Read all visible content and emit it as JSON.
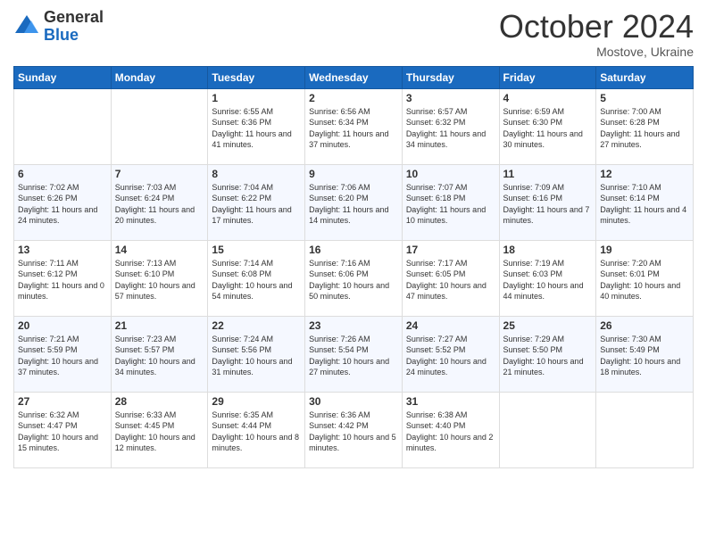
{
  "logo": {
    "general": "General",
    "blue": "Blue"
  },
  "header": {
    "month": "October 2024",
    "location": "Mostove, Ukraine"
  },
  "weekdays": [
    "Sunday",
    "Monday",
    "Tuesday",
    "Wednesday",
    "Thursday",
    "Friday",
    "Saturday"
  ],
  "weeks": [
    [
      {
        "day": "",
        "info": ""
      },
      {
        "day": "",
        "info": ""
      },
      {
        "day": "1",
        "info": "Sunrise: 6:55 AM\nSunset: 6:36 PM\nDaylight: 11 hours and 41 minutes."
      },
      {
        "day": "2",
        "info": "Sunrise: 6:56 AM\nSunset: 6:34 PM\nDaylight: 11 hours and 37 minutes."
      },
      {
        "day": "3",
        "info": "Sunrise: 6:57 AM\nSunset: 6:32 PM\nDaylight: 11 hours and 34 minutes."
      },
      {
        "day": "4",
        "info": "Sunrise: 6:59 AM\nSunset: 6:30 PM\nDaylight: 11 hours and 30 minutes."
      },
      {
        "day": "5",
        "info": "Sunrise: 7:00 AM\nSunset: 6:28 PM\nDaylight: 11 hours and 27 minutes."
      }
    ],
    [
      {
        "day": "6",
        "info": "Sunrise: 7:02 AM\nSunset: 6:26 PM\nDaylight: 11 hours and 24 minutes."
      },
      {
        "day": "7",
        "info": "Sunrise: 7:03 AM\nSunset: 6:24 PM\nDaylight: 11 hours and 20 minutes."
      },
      {
        "day": "8",
        "info": "Sunrise: 7:04 AM\nSunset: 6:22 PM\nDaylight: 11 hours and 17 minutes."
      },
      {
        "day": "9",
        "info": "Sunrise: 7:06 AM\nSunset: 6:20 PM\nDaylight: 11 hours and 14 minutes."
      },
      {
        "day": "10",
        "info": "Sunrise: 7:07 AM\nSunset: 6:18 PM\nDaylight: 11 hours and 10 minutes."
      },
      {
        "day": "11",
        "info": "Sunrise: 7:09 AM\nSunset: 6:16 PM\nDaylight: 11 hours and 7 minutes."
      },
      {
        "day": "12",
        "info": "Sunrise: 7:10 AM\nSunset: 6:14 PM\nDaylight: 11 hours and 4 minutes."
      }
    ],
    [
      {
        "day": "13",
        "info": "Sunrise: 7:11 AM\nSunset: 6:12 PM\nDaylight: 11 hours and 0 minutes."
      },
      {
        "day": "14",
        "info": "Sunrise: 7:13 AM\nSunset: 6:10 PM\nDaylight: 10 hours and 57 minutes."
      },
      {
        "day": "15",
        "info": "Sunrise: 7:14 AM\nSunset: 6:08 PM\nDaylight: 10 hours and 54 minutes."
      },
      {
        "day": "16",
        "info": "Sunrise: 7:16 AM\nSunset: 6:06 PM\nDaylight: 10 hours and 50 minutes."
      },
      {
        "day": "17",
        "info": "Sunrise: 7:17 AM\nSunset: 6:05 PM\nDaylight: 10 hours and 47 minutes."
      },
      {
        "day": "18",
        "info": "Sunrise: 7:19 AM\nSunset: 6:03 PM\nDaylight: 10 hours and 44 minutes."
      },
      {
        "day": "19",
        "info": "Sunrise: 7:20 AM\nSunset: 6:01 PM\nDaylight: 10 hours and 40 minutes."
      }
    ],
    [
      {
        "day": "20",
        "info": "Sunrise: 7:21 AM\nSunset: 5:59 PM\nDaylight: 10 hours and 37 minutes."
      },
      {
        "day": "21",
        "info": "Sunrise: 7:23 AM\nSunset: 5:57 PM\nDaylight: 10 hours and 34 minutes."
      },
      {
        "day": "22",
        "info": "Sunrise: 7:24 AM\nSunset: 5:56 PM\nDaylight: 10 hours and 31 minutes."
      },
      {
        "day": "23",
        "info": "Sunrise: 7:26 AM\nSunset: 5:54 PM\nDaylight: 10 hours and 27 minutes."
      },
      {
        "day": "24",
        "info": "Sunrise: 7:27 AM\nSunset: 5:52 PM\nDaylight: 10 hours and 24 minutes."
      },
      {
        "day": "25",
        "info": "Sunrise: 7:29 AM\nSunset: 5:50 PM\nDaylight: 10 hours and 21 minutes."
      },
      {
        "day": "26",
        "info": "Sunrise: 7:30 AM\nSunset: 5:49 PM\nDaylight: 10 hours and 18 minutes."
      }
    ],
    [
      {
        "day": "27",
        "info": "Sunrise: 6:32 AM\nSunset: 4:47 PM\nDaylight: 10 hours and 15 minutes."
      },
      {
        "day": "28",
        "info": "Sunrise: 6:33 AM\nSunset: 4:45 PM\nDaylight: 10 hours and 12 minutes."
      },
      {
        "day": "29",
        "info": "Sunrise: 6:35 AM\nSunset: 4:44 PM\nDaylight: 10 hours and 8 minutes."
      },
      {
        "day": "30",
        "info": "Sunrise: 6:36 AM\nSunset: 4:42 PM\nDaylight: 10 hours and 5 minutes."
      },
      {
        "day": "31",
        "info": "Sunrise: 6:38 AM\nSunset: 4:40 PM\nDaylight: 10 hours and 2 minutes."
      },
      {
        "day": "",
        "info": ""
      },
      {
        "day": "",
        "info": ""
      }
    ]
  ]
}
